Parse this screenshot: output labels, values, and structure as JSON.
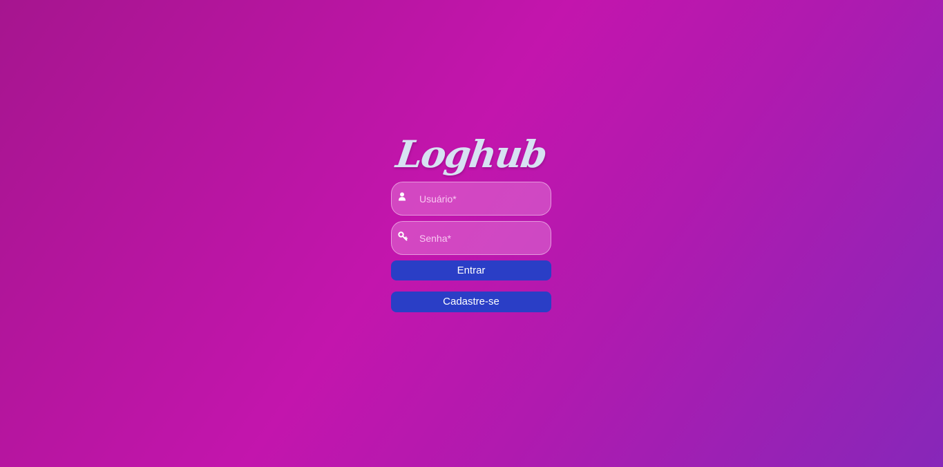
{
  "brand": {
    "logo_text": "Loghub"
  },
  "login_form": {
    "username": {
      "placeholder": "Usuário*",
      "value": "",
      "icon": "user-icon"
    },
    "password": {
      "placeholder": "Senha*",
      "value": "",
      "icon": "key-icon"
    },
    "submit_label": "Entrar",
    "register_label": "Cadastre-se"
  },
  "colors": {
    "background_start": "#a6158f",
    "background_mid": "#c315ad",
    "background_end": "#8727b9",
    "button": "#2a3ec6",
    "logo": "#d7e2f2"
  }
}
